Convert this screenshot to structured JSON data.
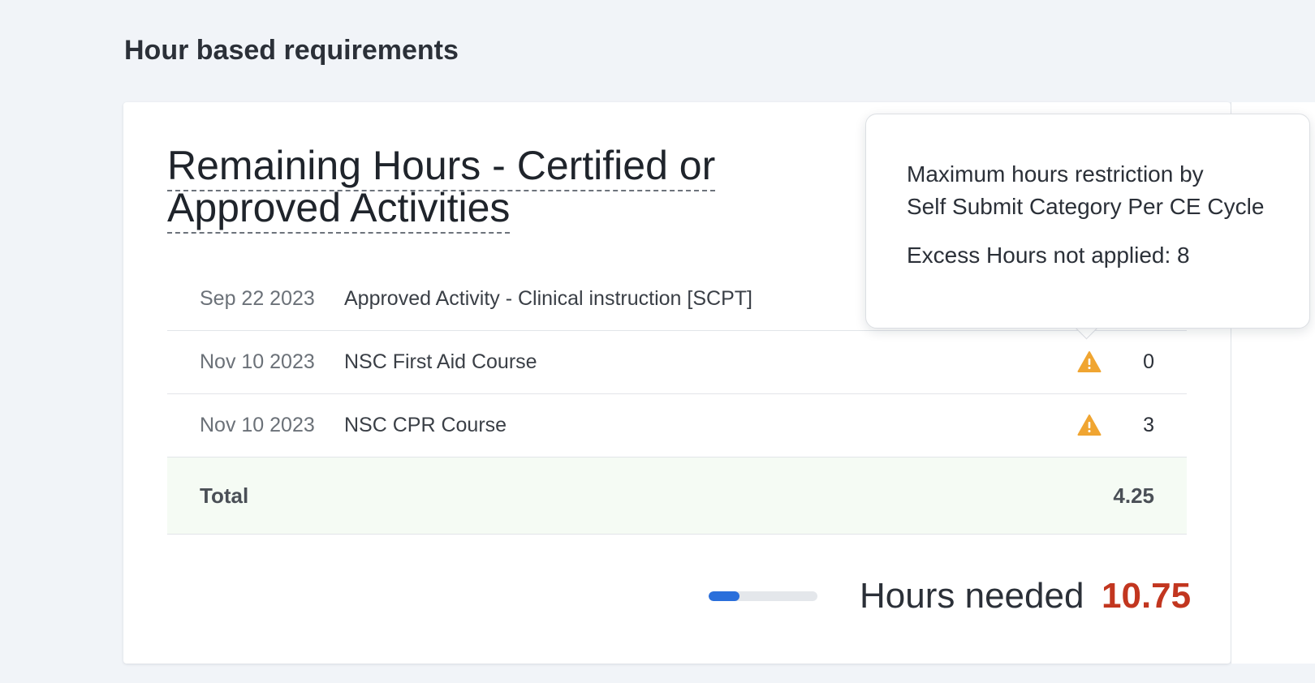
{
  "section": {
    "title": "Hour based requirements"
  },
  "card": {
    "title": "Remaining Hours - Certified or Approved Activities",
    "rows": [
      {
        "date": "Sep 22 2023",
        "name": "Approved Activity - Clinical instruction [SCPT]",
        "hours": "",
        "warning": false
      },
      {
        "date": "Nov 10 2023",
        "name": "NSC First Aid Course",
        "hours": "0",
        "warning": true
      },
      {
        "date": "Nov 10 2023",
        "name": "NSC CPR Course",
        "hours": "3",
        "warning": true
      }
    ],
    "total": {
      "label": "Total",
      "value": "4.25"
    },
    "progress": {
      "fraction": 0.28
    },
    "hours_needed": {
      "label": "Hours needed",
      "value": "10.75"
    }
  },
  "tooltip": {
    "line1": "Maximum hours restriction by",
    "line2": "Self Submit Category Per CE Cycle",
    "excess": "Excess Hours not applied: 8"
  },
  "colors": {
    "accent_blue": "#2a6fdb",
    "needed_red": "#c2361f",
    "warning_orange": "#f0a531",
    "total_bg": "#f5fbf4"
  },
  "icons": {
    "warning": "warning-icon"
  }
}
